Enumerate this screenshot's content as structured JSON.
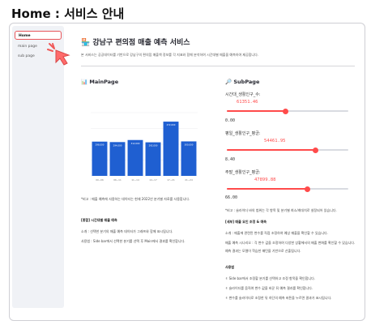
{
  "caption": "Home : 서비스 안내",
  "sidebar": {
    "items": [
      {
        "label": "Home",
        "active": true
      },
      {
        "label": "main page",
        "active": false
      },
      {
        "label": "sub page",
        "active": false
      }
    ]
  },
  "header": {
    "icon": "store-icon",
    "title": "강남구 편의점 매출 예측 서비스",
    "description": "본 서비스는 공공데이터를 기반으로 강남구의 편의점 매출액 정보를 각 지표와 함께 분석하여 시간대별 매출을 예측하여 제공합니다."
  },
  "main_page": {
    "icon": "bar-chart-icon",
    "title": "MainPage",
    "chart_note": "*비고 : 매출 예측에 사용하는 데이터는 현재 2022년 분기별 자료를 사용합니다.",
    "guide_title": "[종합] 시간대별 매출 예측",
    "guide_lines": [
      "소개 : 선택한 분기의 매출 예측 데이터가 그래프와 함께 표시됩니다.",
      "사용법 : Side bar에서 선택한 분기를 선택 후 Main에서 결과를 확인합니다."
    ]
  },
  "sub_page": {
    "icon": "search-icon",
    "title": "SubPage",
    "sliders": [
      {
        "label": "시간대_생활인구_수:",
        "value": "61351.46",
        "min": "0.00",
        "fraction": 0.48
      },
      {
        "label": "평일_생활인구_평균:",
        "value": "54461.95",
        "min": "8.40",
        "fraction": 0.73
      },
      {
        "label": "주말_생활인구_평균:",
        "value": "47899.88",
        "min": "66.00",
        "fraction": 0.66
      }
    ],
    "note": "*비고 : 슬라이더 바의 범위는 각 항목 및 분기별 최소/최대치로 설정되어 있습니다.",
    "detail_title": "[세부] 매출 요인 조정 & 예측",
    "detail_lines": [
      "소개 : 매출에 관련된 변수를 직접 조정하여 예상 매출을 확인할 수 있습니다.",
      "매출 예측 시나리오 : 각 변수 값을 조정하여 다양한 상황에서의 매출 변화를 확인할 수 있습니다.",
      "예측 결과는 모델이 학습한 패턴을 기반으로 산출됩니다."
    ],
    "usage_title": "사용법",
    "usage_lines": [
      "Side bar에서 조정할 분기를 선택하고 조정 항목을 확인합니다.",
      "슬라이더를 움직여 변수 값을 바꾼 뒤 예측 결과를 확인합니다.",
      "변수를 슬라이더로 조정한 뒤 하단의 예측 버튼을 누르면 결과가 표시됩니다."
    ]
  },
  "chart_data": {
    "type": "bar",
    "categories": [
      "00~06",
      "06~11",
      "11~14",
      "14~17",
      "17~21",
      "21~24"
    ],
    "values": [
      298,
      294,
      312,
      292,
      472,
      300
    ],
    "value_labels": [
      "298,000",
      "294,000",
      "312,000",
      "292,000",
      "472,000",
      "300,000"
    ],
    "ylim": [
      0,
      550
    ],
    "color": "#1f5fd1"
  }
}
